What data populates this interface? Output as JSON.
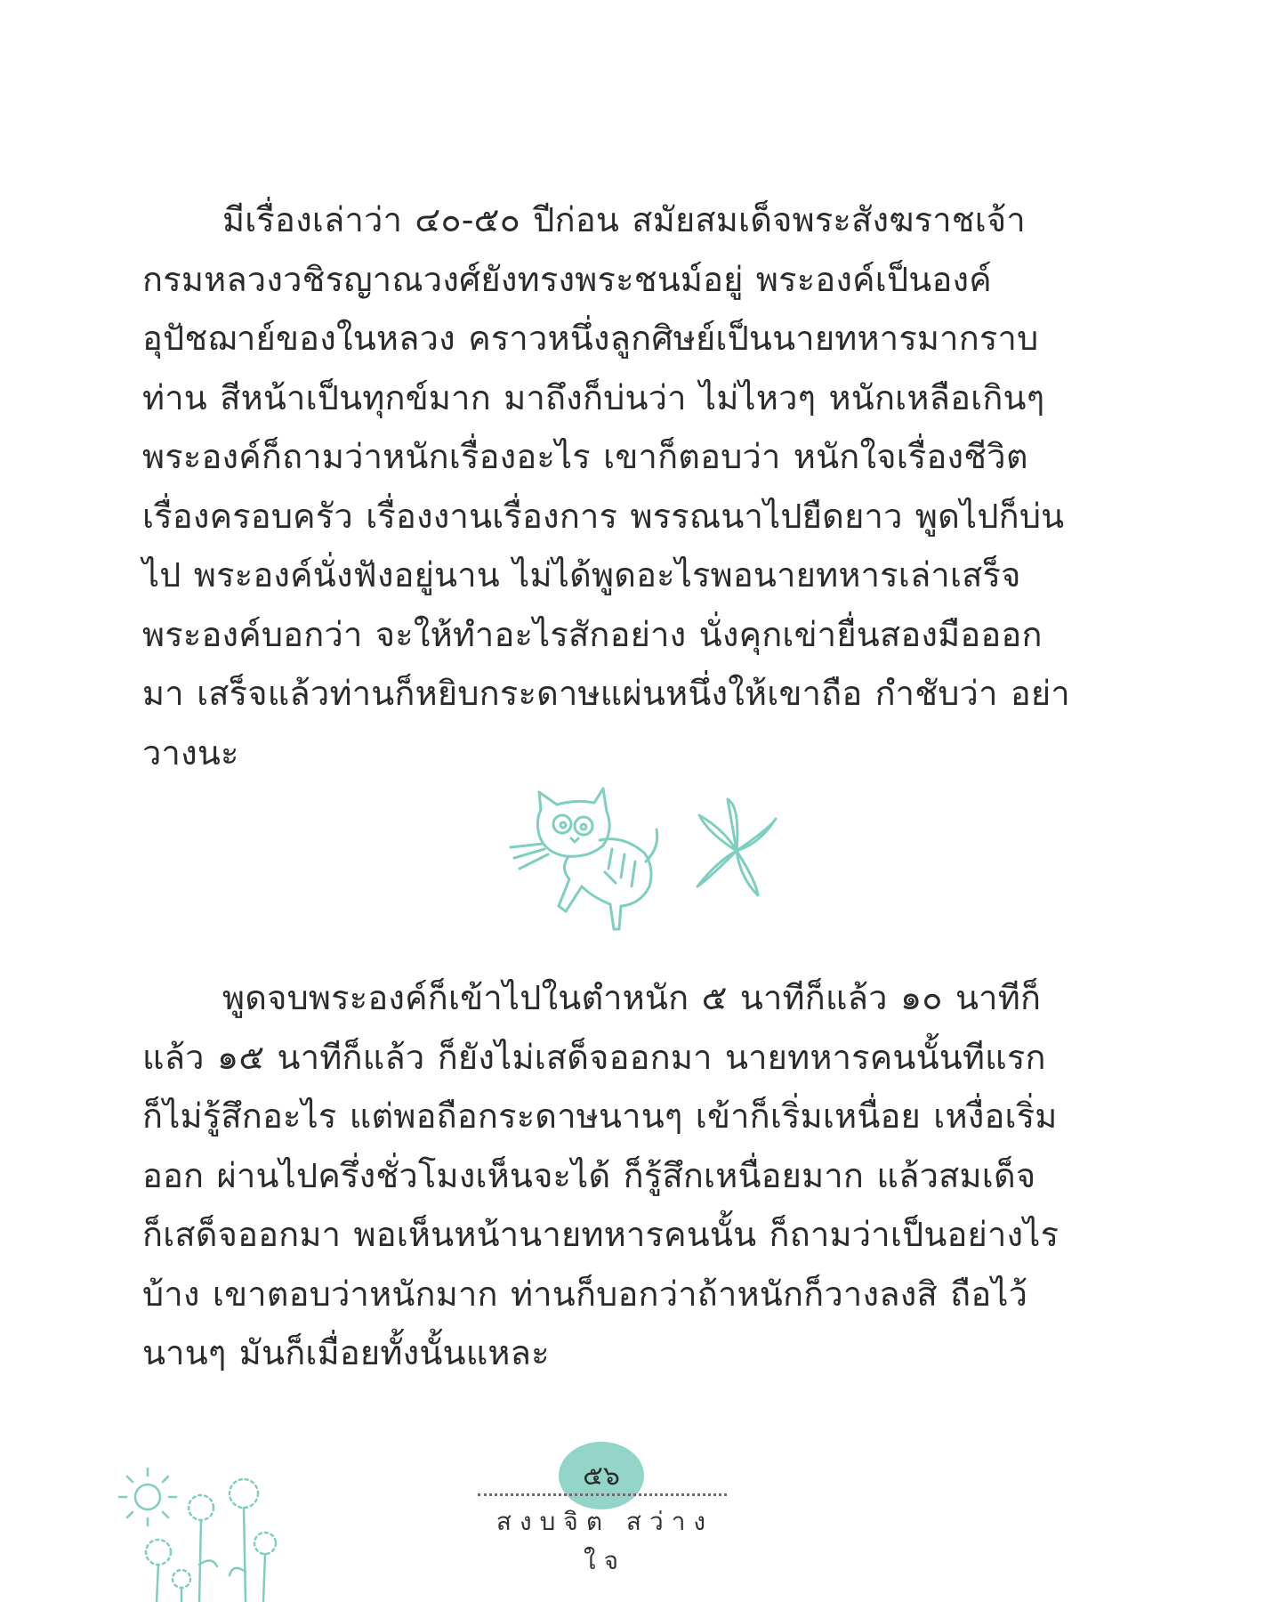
{
  "paragraph1": [
    "มีเรื่องเล่าว่า ๔๐-๕๐ ปีก่อน สมัยสมเด็จพระสังฆราชเจ้า",
    "กรมหลวงวชิรญาณวงศ์ยังทรงพระชนม์อยู่ พระองค์เป็นองค์",
    "อุปัชฌาย์ของในหลวง คราวหนึ่งลูกศิษย์เป็นนายทหารมากราบ",
    "ท่าน สีหน้าเป็นทุกข์มาก มาถึงก็บ่นว่า ไม่ไหวๆ หนักเหลือเกินๆ",
    "พระองค์ก็ถามว่าหนักเรื่องอะไร เขาก็ตอบว่า หนักใจเรื่องชีวิต",
    "เรื่องครอบครัว เรื่องงานเรื่องการ พรรณนาไปยืดยาว พูดไปก็บ่น",
    "ไป พระองค์นั่งฟังอยู่นาน ไม่ได้พูดอะไรพอนายทหารเล่าเสร็จ",
    "พระองค์บอกว่า จะให้ทำอะไรสักอย่าง นั่งคุกเข่ายื่นสองมือออก",
    "มา เสร็จแล้วท่านก็หยิบกระดาษแผ่นหนึ่งให้เขาถือ กำชับว่า อย่า",
    "วางนะ"
  ],
  "paragraph2": [
    "พูดจบพระองค์ก็เข้าไปในตำหนัก ๕ นาทีก็แล้ว ๑๐ นาทีก็",
    "แล้ว ๑๕ นาทีก็แล้ว ก็ยังไม่เสด็จออกมา นายทหารคนนั้นทีแรก",
    "ก็ไม่รู้สึกอะไร แต่พอถือกระดาษนานๆ เข้าก็เริ่มเหนื่อย เหงื่อเริ่ม",
    "ออก ผ่านไปครึ่งชั่วโมงเห็นจะได้ ก็รู้สึกเหนื่อยมาก แล้วสมเด็จ",
    "ก็เสด็จออกมา พอเห็นหน้านายทหารคนนั้น ก็ถามว่าเป็นอย่างไร",
    "บ้าง เขาตอบว่าหนักมาก ท่านก็บอกว่าถ้าหนักก็วางลงสิ ถือไว้",
    "นานๆ มันก็เมื่อยทั้งนั้นแหละ"
  ],
  "footer": {
    "page_number": "๕๖",
    "book_title": "สงบจิต สว่างใจ"
  },
  "colors": {
    "accent": "#93d6c9",
    "illustration": "#7fcfc0",
    "text": "#2b2b2b"
  },
  "icons": [
    "cat-illustration-icon",
    "flower-illustration-icon",
    "sun-icon",
    "dandelion-flowers-icon"
  ]
}
